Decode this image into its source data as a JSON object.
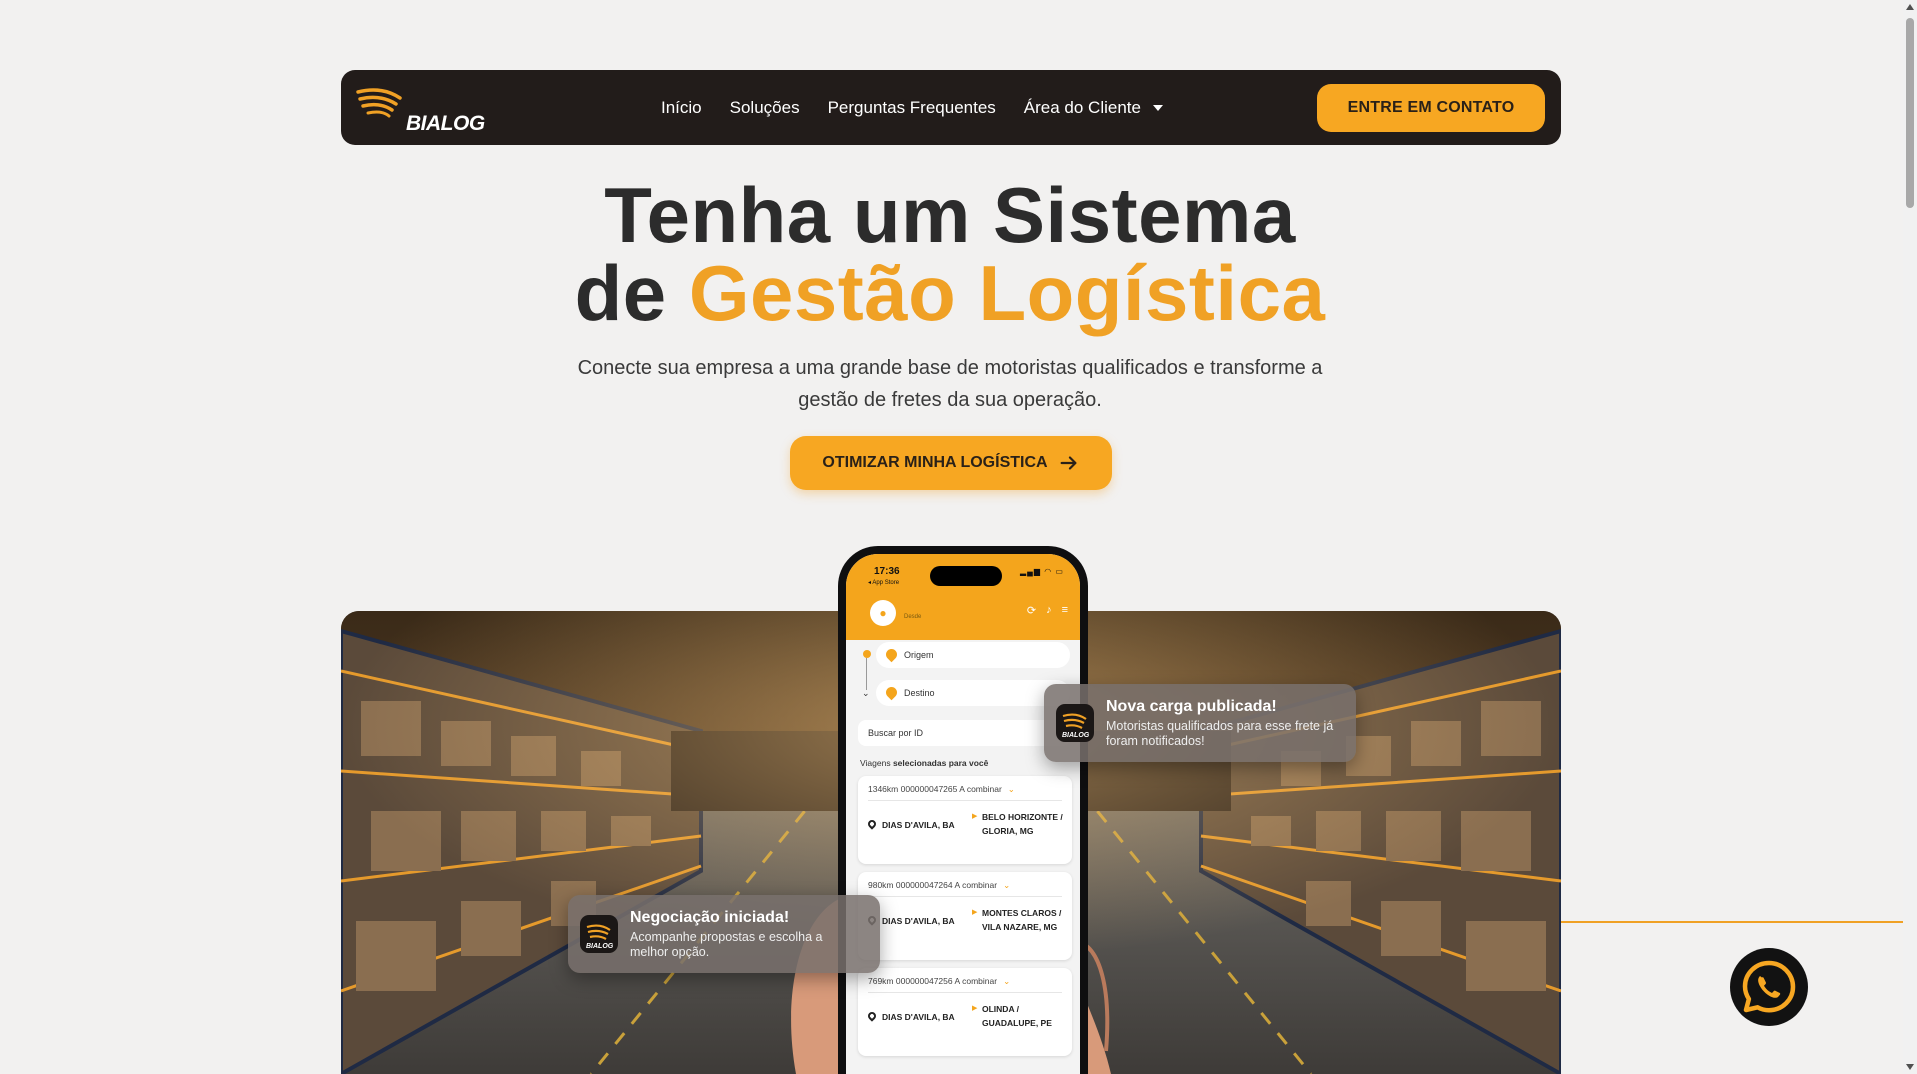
{
  "nav": {
    "brand": "BIALOG",
    "links": [
      "Início",
      "Soluções",
      "Perguntas Frequentes",
      "Área do Cliente"
    ],
    "cta": "ENTRE EM CONTATO"
  },
  "hero": {
    "title_line1": "Tenha um Sistema",
    "title_line2_prefix": "de ",
    "title_line2_accent": "Gestão Logística",
    "subtitle": "Conecte sua empresa a uma grande base de motoristas qualificados e transforme a gestão de fretes da sua operação.",
    "button": "OTIMIZAR MINHA LOGÍSTICA"
  },
  "phone": {
    "time": "17:36",
    "back_label": "◂ App Store",
    "desde": "Desde",
    "origem": "Origem",
    "destino": "Destino",
    "buscar": "Buscar por ID",
    "viagens_prefix": "Viagens ",
    "viagens_bold": "selecionadas para você",
    "trips": [
      {
        "km": "1346km",
        "id": "000000047265",
        "price": "A combinar",
        "from": "DIAS D'AVILA, BA",
        "to": "BELO HORIZONTE / GLORIA, MG"
      },
      {
        "km": "980km",
        "id": "000000047264",
        "price": "A combinar",
        "from": "DIAS D'AVILA, BA",
        "to": "MONTES CLAROS / VILA NAZARE, MG"
      },
      {
        "km": "769km",
        "id": "000000047256",
        "price": "A combinar",
        "from": "DIAS D'AVILA, BA",
        "to": "OLINDA / GUADALUPE, PE"
      }
    ]
  },
  "toasts": {
    "carga": {
      "title": "Nova carga publicada!",
      "body": "Motoristas qualificados para esse frete já foram notificados!"
    },
    "negociacao": {
      "title": "Negociação iniciada!",
      "body": "Acompanhe propostas e escolha a melhor opção."
    }
  },
  "colors": {
    "accent": "#f7a722",
    "nav_bg": "#221c1a",
    "page_bg": "#f2f1f0"
  },
  "icons": [
    "bialog-logo-icon",
    "caret-down-icon",
    "arrow-right-icon",
    "whatsapp-icon"
  ]
}
